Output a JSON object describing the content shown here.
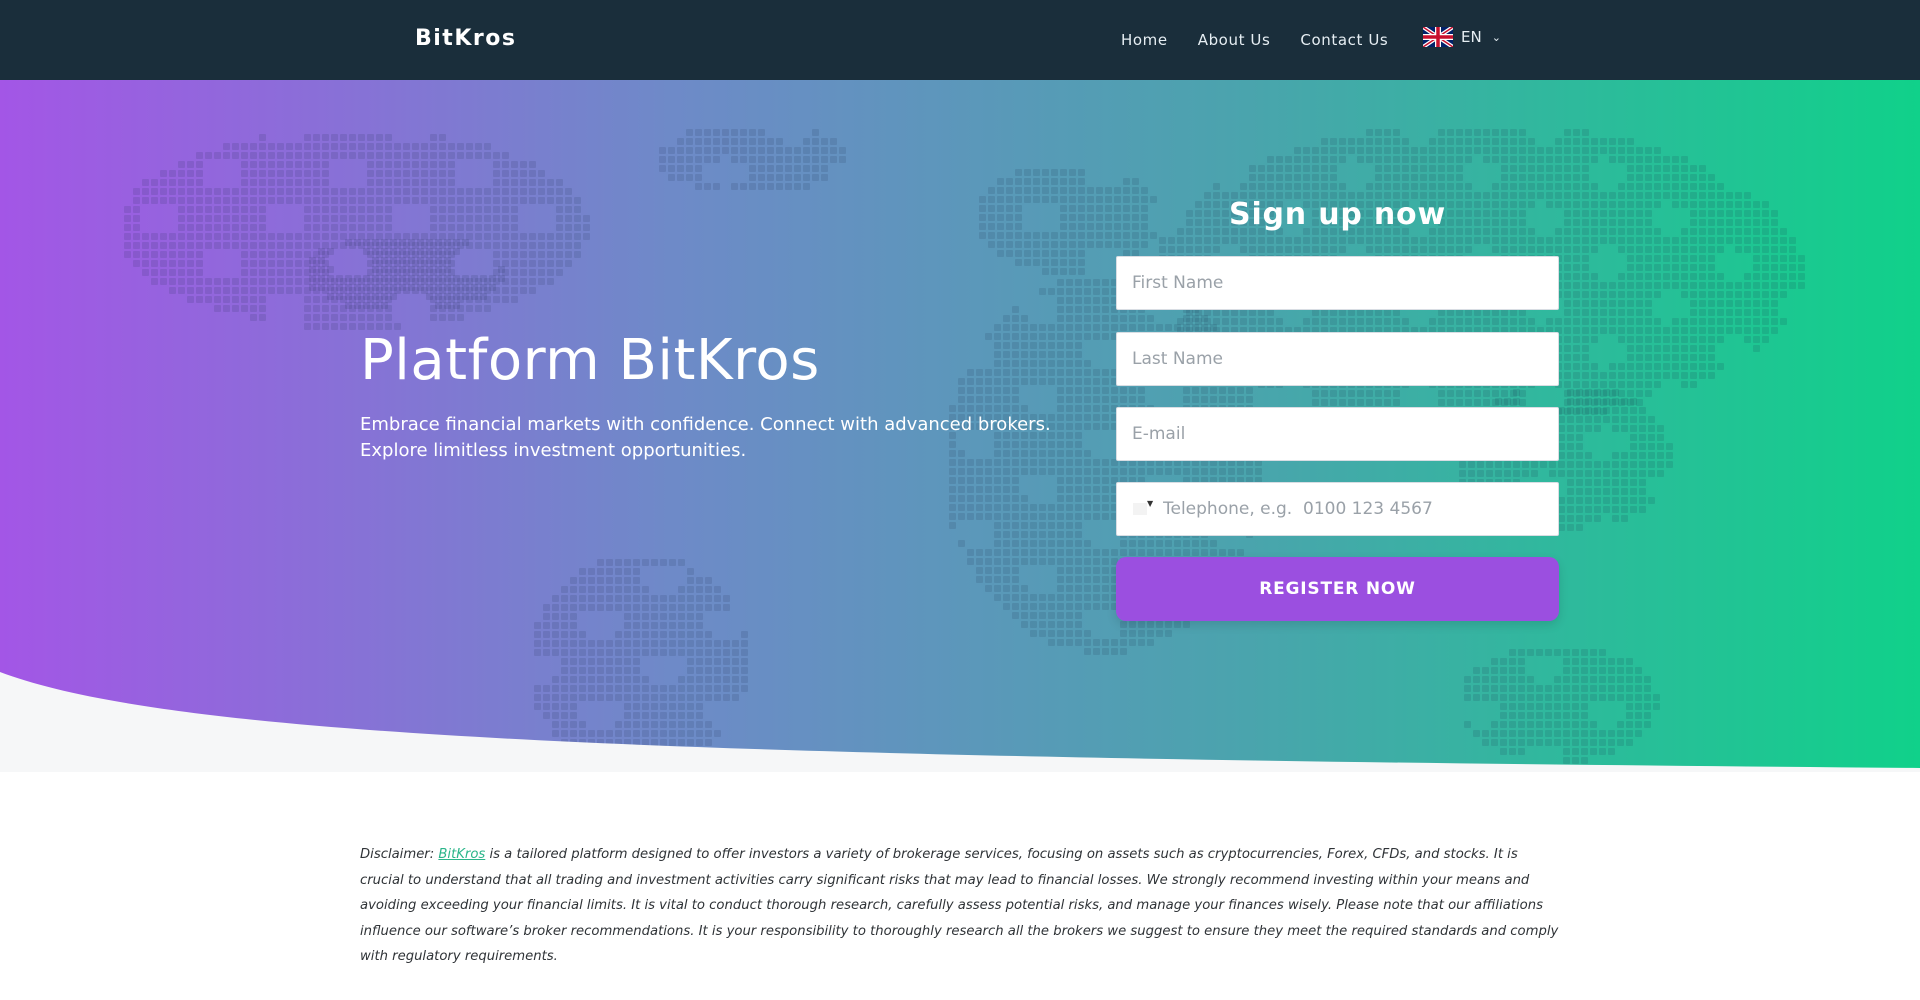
{
  "nav": {
    "logo": "BitKros",
    "links": [
      "Home",
      "About Us",
      "Contact Us"
    ],
    "language": {
      "code": "EN",
      "flag_icon": "uk-flag-icon"
    }
  },
  "hero": {
    "title": "Platform BitKros",
    "subtitle": "Embrace financial markets with confidence. Connect with advanced brokers. Explore limitless investment opportunities."
  },
  "form": {
    "title": "Sign up now",
    "first_name_placeholder": "First Name",
    "last_name_placeholder": "Last Name",
    "email_placeholder": "E-mail",
    "phone_placeholder": "Telephone, e.g.  0100 123 4567",
    "submit_label": "REGISTER NOW"
  },
  "disclaimer": {
    "prefix": "Disclaimer: ",
    "link_text": "BitKros",
    "body": " is a tailored platform designed to offer investors a variety of brokerage services, focusing on assets such as cryptocurrencies, Forex, CFDs, and stocks. It is crucial to understand that all trading and investment activities carry significant risks that may lead to financial losses. We strongly recommend investing within your means and avoiding exceeding your financial limits. It is vital to conduct thorough research, carefully assess potential risks, and manage your finances wisely. Please note that our affiliations influence our software’s broker recommendations. It is your responsibility to thoroughly research all the brokers we suggest to ensure they meet the required standards and comply with regulatory requirements."
  },
  "colors": {
    "nav_bg": "#1a2e3b",
    "gradient_start": "#a356e6",
    "gradient_end": "#10d18a",
    "button": "#9b4fe0",
    "link": "#2bb58a"
  }
}
